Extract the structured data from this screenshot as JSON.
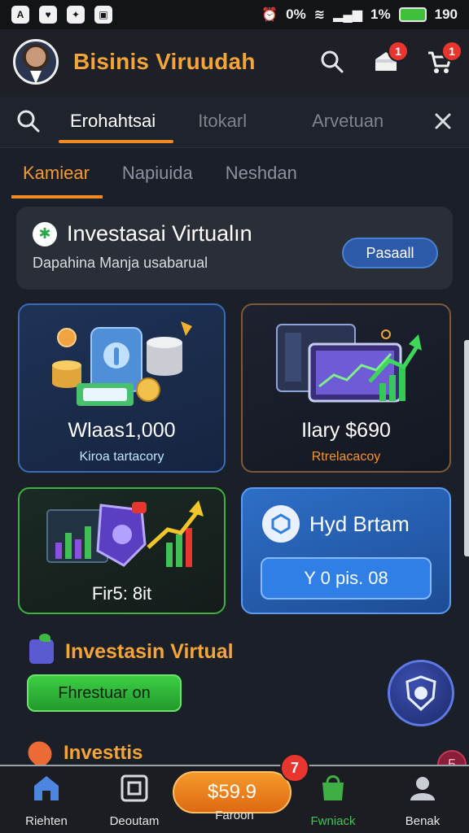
{
  "status_bar": {
    "icons": [
      "app-icon-1",
      "app-icon-2",
      "app-icon-3",
      "app-icon-4"
    ],
    "battery_percent_text": "1%",
    "time_text": "190",
    "alarm_text": "0%"
  },
  "header": {
    "app_title": "Bisinis Viruudah",
    "search_icon": "search-icon",
    "notifications": {
      "icon": "shop-icon",
      "badge": "1"
    },
    "cart": {
      "icon": "cart-icon",
      "badge": "1"
    }
  },
  "search_tabs": {
    "items": [
      {
        "label": "Erohahtsai",
        "active": true
      },
      {
        "label": "Itokarl",
        "active": false
      },
      {
        "label": "Arvetuan",
        "active": false
      }
    ],
    "close_icon": "close-icon"
  },
  "category_tabs": {
    "items": [
      {
        "label": "Kamiear",
        "active": true
      },
      {
        "label": "Napiuida",
        "active": false
      },
      {
        "label": "Neshdan",
        "active": false
      }
    ]
  },
  "banner": {
    "title": "Investasai Virtualın",
    "subtitle": "Dapahina Manja usabarual",
    "button_label": "Pasaall"
  },
  "cards": [
    {
      "value": "Wlaas1,000",
      "sub": "Kiroa tartacory",
      "sub_color": "#bfe6ff"
    },
    {
      "value": "Ilary $690",
      "sub": "Rtrelacacoy",
      "sub_color": "#f5952f"
    },
    {
      "value": "Fir5: 8it"
    },
    {
      "title": "Hyd Brtam",
      "button_label": "Y 0 pis. 08"
    }
  ],
  "section": {
    "title": "Investasin Virtual",
    "button_label": "Fhrestuar on"
  },
  "section2": {
    "title": "Investtis"
  },
  "bottom_nav": {
    "items": [
      {
        "label": "Riehten",
        "icon": "home-icon"
      },
      {
        "label": "Deoutam",
        "icon": "wallet-icon"
      },
      {
        "label": "Faroon",
        "icon": "coin-icon"
      },
      {
        "label": "Fwniack",
        "icon": "bag-icon",
        "active": true
      },
      {
        "label": "Benak",
        "icon": "profile-icon"
      }
    ],
    "pay_button_label": "$59.9",
    "pay_badge": "7",
    "corner_badge": "5"
  },
  "colors": {
    "accent": "#f5a43a",
    "background": "#1b1f27",
    "success": "#3fb13f",
    "primary": "#2f7fe6",
    "danger": "#e8362e"
  }
}
